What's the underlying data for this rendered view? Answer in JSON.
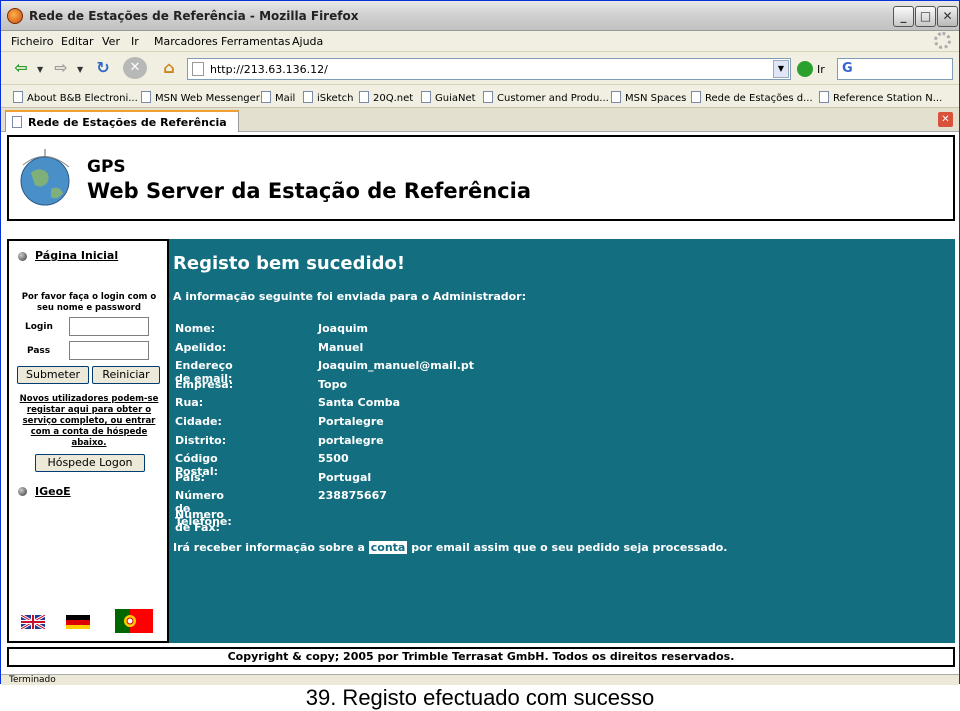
{
  "window": {
    "title": "Rede de Estações de Referência - Mozilla Firefox",
    "min_glyph": "_",
    "max_glyph": "□",
    "close_glyph": "✕"
  },
  "menu": [
    "Ficheiro",
    "Editar",
    "Ver",
    "Ir",
    "Marcadores",
    "Ferramentas",
    "Ajuda"
  ],
  "toolbar": {
    "url": "http://213.63.136.12/",
    "go_label": "Ir",
    "search_engine": "G"
  },
  "bookmarks": [
    "About B&B Electroni...",
    "MSN Web Messenger",
    "Mail",
    "iSketch",
    "20Q.net",
    "GuiaNet",
    "Customer and Produ...",
    "MSN Spaces",
    "Rede de Estações d...",
    "Reference Station N..."
  ],
  "tab": {
    "label": "Rede de Estações de Referência"
  },
  "banner": {
    "gps": "GPS",
    "title": "Web Server da Estação de Referência"
  },
  "sidebar": {
    "home_link": "Página Inicial",
    "login_hint": "Por favor faça o login com o seu nome e password",
    "login_label": "Login",
    "pass_label": "Pass",
    "submit_label": "Submeter",
    "reset_label": "Reiniciar",
    "new_users": "Novos utilizadores podem-se registar aqui para obter o serviço completo, ou entrar com a conta de hóspede abaixo.",
    "guest_label": "Hóspede Logon",
    "igeoe_link": "IGeoE"
  },
  "main": {
    "heading": "Registo bem sucedido!",
    "sub": "A informação seguinte foi enviada para o Administrador:",
    "rows": [
      {
        "k": "Nome:",
        "v": "Joaquim"
      },
      {
        "k": "Apelido:",
        "v": "Manuel"
      },
      {
        "k": "Endereço de email:",
        "v": "Joaquim_manuel@mail.pt"
      },
      {
        "k": "Empresa:",
        "v": "Topo"
      },
      {
        "k": "Rua:",
        "v": "Santa Comba"
      },
      {
        "k": "Cidade:",
        "v": "Portalegre"
      },
      {
        "k": "Distrito:",
        "v": "portalegre"
      },
      {
        "k": "Código Postal:",
        "v": "5500"
      },
      {
        "k": "País:",
        "v": "Portugal"
      },
      {
        "k": "Número de Telefone:",
        "v": "238875667"
      },
      {
        "k": "Número de Fax:",
        "v": ""
      }
    ],
    "notice_before": "Irá receber informação sobre a ",
    "notice_highlight": "conta",
    "notice_after": " por email assim que o seu pedido seja processado."
  },
  "footer": "Copyright & copy; 2005 por Trimble Terrasat GmbH. Todos os direitos reservados.",
  "status": "Terminado",
  "caption": "39. Registo efectuado com sucesso",
  "colors": {
    "content_bg": "#136f80",
    "tab_accent": "#f0a030"
  }
}
